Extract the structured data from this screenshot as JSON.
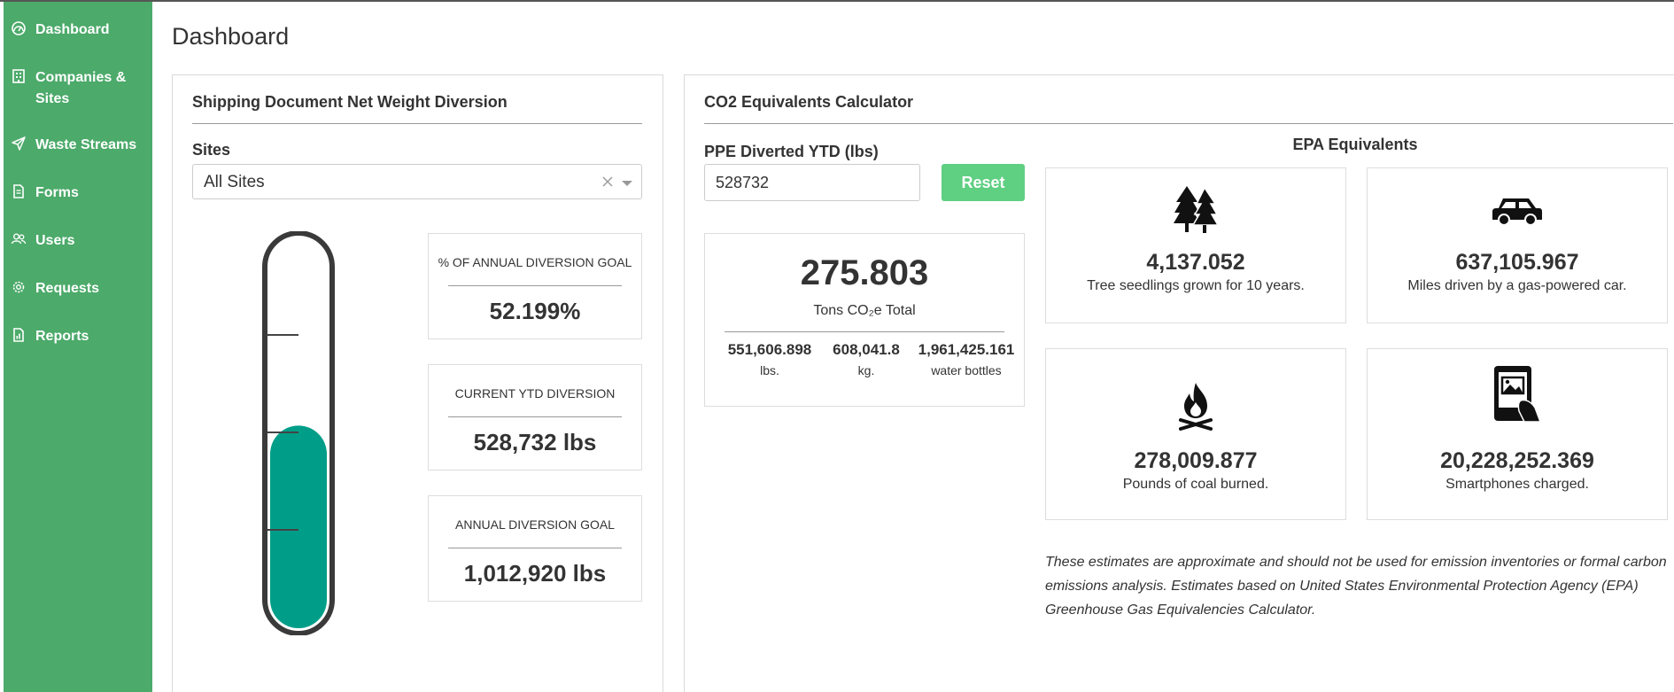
{
  "sidebar": {
    "items": [
      {
        "label": "Dashboard",
        "icon": "dashboard-icon"
      },
      {
        "label": "Companies & Sites",
        "icon": "building-icon"
      },
      {
        "label": "Waste Streams",
        "icon": "paper-plane-icon"
      },
      {
        "label": "Forms",
        "icon": "document-icon"
      },
      {
        "label": "Users",
        "icon": "users-icon"
      },
      {
        "label": "Requests",
        "icon": "gear-icon"
      },
      {
        "label": "Reports",
        "icon": "report-icon"
      }
    ],
    "color": "#4caa6a"
  },
  "header": {
    "title": "Dashboard"
  },
  "shipping": {
    "title": "Shipping Document Net Weight Diversion",
    "sites_label": "Sites",
    "sites_value": "All Sites",
    "fill_fraction": 0.52199,
    "fill_color": "#009e88",
    "stats": [
      {
        "label": "% OF ANNUAL DIVERSION GOAL",
        "value": "52.199%"
      },
      {
        "label": "CURRENT YTD DIVERSION",
        "value": "528,732 lbs"
      },
      {
        "label": "ANNUAL DIVERSION GOAL",
        "value": "1,012,920 lbs"
      }
    ]
  },
  "calculator": {
    "title": "CO2 Equivalents Calculator",
    "ppe_label": "PPE Diverted YTD (lbs)",
    "ppe_value": "528732",
    "reset_label": "Reset",
    "reset_color": "#5fcf82",
    "total_value": "275.803",
    "total_label": "Tons CO₂e Total",
    "breakdown": [
      {
        "value": "551,606.898",
        "unit": "lbs."
      },
      {
        "value": "608,041.8",
        "unit": "kg."
      },
      {
        "value": "1,961,425.161",
        "unit": "water bottles"
      }
    ],
    "epa_heading": "EPA Equivalents",
    "epa": [
      {
        "icon": "trees-icon",
        "value": "4,137.052",
        "desc": "Tree seedlings grown for 10 years."
      },
      {
        "icon": "car-icon",
        "value": "637,105.967",
        "desc": "Miles driven by a gas-powered car."
      },
      {
        "icon": "campfire-icon",
        "value": "278,009.877",
        "desc": "Pounds of coal burned."
      },
      {
        "icon": "smartphone-icon",
        "value": "20,228,252.369",
        "desc": "Smartphones charged."
      }
    ],
    "disclaimer": "These estimates are approximate and should not be used for emission inventories or formal carbon emissions analysis. Estimates based on United States Environmental Protection Agency (EPA) Greenhouse Gas Equivalencies Calculator."
  }
}
